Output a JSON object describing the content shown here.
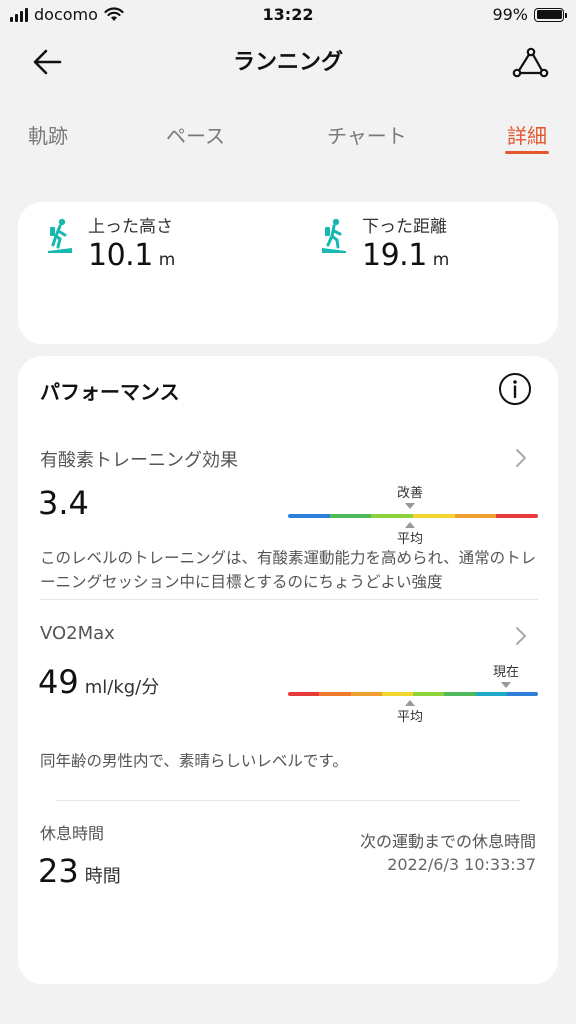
{
  "status_bar": {
    "carrier": "docomo",
    "time": "13:22",
    "battery": "99%"
  },
  "header": {
    "title": "ランニング"
  },
  "tabs": [
    {
      "label": "軌跡",
      "active": false
    },
    {
      "label": "ペース",
      "active": false
    },
    {
      "label": "チャート",
      "active": false
    },
    {
      "label": "詳細",
      "active": true
    }
  ],
  "elevation": {
    "up": {
      "label": "上った高さ",
      "value": "10.1",
      "unit": "m",
      "icon": "hiker-uphill-icon"
    },
    "down": {
      "label": "下った距離",
      "value": "19.1",
      "unit": "m",
      "icon": "hiker-downhill-icon"
    }
  },
  "performance": {
    "title": "パフォーマンス",
    "aerobic": {
      "label": "有酸素トレーニング効果",
      "value": "3.4",
      "marker_top": "改善",
      "marker_bottom": "平均",
      "description": "このレベルのトレーニングは、有酸素運動能力を高められ、通常のトレーニングセッション中に目標とするのにちょうどよい強度"
    },
    "vo2max": {
      "label": "VO2Max",
      "value": "49",
      "unit": "ml/kg/分",
      "marker_top": "現在",
      "marker_bottom": "平均",
      "description": "同年齢の男性内で、素晴らしいレベルです。"
    },
    "rest": {
      "label": "休息時間",
      "value": "23",
      "unit": "時間",
      "next_label": "次の運動までの休息時間",
      "next_time": "2022/6/3 10:33:37"
    }
  },
  "colors": {
    "accent": "#e4572e",
    "icon_teal": "#17b8b0",
    "scale1": [
      "#2f7fd8",
      "#4fb85a",
      "#8ed23b",
      "#f0d530",
      "#f0a030",
      "#e63a3a"
    ],
    "scale2": [
      "#e63a3a",
      "#f07a2e",
      "#f0a030",
      "#f0d530",
      "#8ed23b",
      "#4fb85a",
      "#1fa8c8",
      "#2f7fd8"
    ]
  }
}
